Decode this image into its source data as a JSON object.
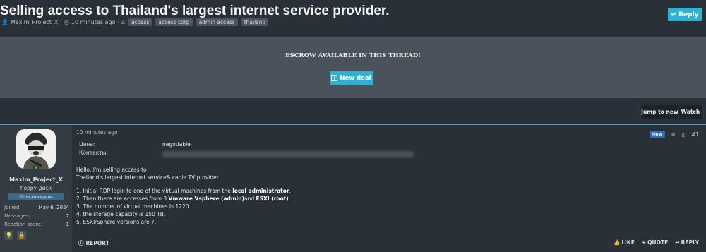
{
  "thread": {
    "title": "Selling access to Thailand's largest internet service provider.",
    "author": "Maxim_Project_X",
    "time": "10 minutes ago",
    "tags": [
      "access",
      "access corp",
      "admin access",
      "thailand"
    ]
  },
  "header": {
    "reply_label": "Reply"
  },
  "escrow": {
    "title": "ESCROW AVAILABLE IN THIS THREAD!",
    "new_deal_label": "New deal"
  },
  "toolbar": {
    "jump_label": "Jump to new",
    "watch_label": "Watch"
  },
  "post": {
    "user": {
      "name": "Maxim_Project_X",
      "title": "floppy-диск",
      "banner": "Пользователь",
      "stats": [
        {
          "label": "Joined:",
          "value": "May 6, 2024"
        },
        {
          "label": "Messages:",
          "value": "7"
        },
        {
          "label": "Reaction score:",
          "value": "1"
        }
      ]
    },
    "date": "10 minutes ago",
    "new_badge": "New",
    "number": "#1",
    "fields": [
      {
        "label": "Цена:",
        "value": "negotiable"
      },
      {
        "label": "Контакты:",
        "value": ""
      }
    ],
    "lines": [
      "Hello, I'm selling access to",
      "Thailand's largest internet service& cable TV provider",
      "",
      "1. Initial RDP login to one of the virtual machines from the ",
      "2. Then there are accesses from 3 ",
      "3. The number of virtual machines is 1220.",
      "4. the storage capacity is 150 TB.",
      "5. ESXI/Sphere versions are 7."
    ],
    "line1_bold": "local administrator",
    "line1_tail": ".",
    "line2_bold_a": "Vmware Vsphere (admin)",
    "line2_mid": "and ",
    "line2_bold_b": "ESXI (root)",
    "line2_tail": ".",
    "report_label": "REPORT",
    "like_label": "LIKE",
    "quote_label": "QUOTE",
    "reply_label": "REPLY"
  }
}
